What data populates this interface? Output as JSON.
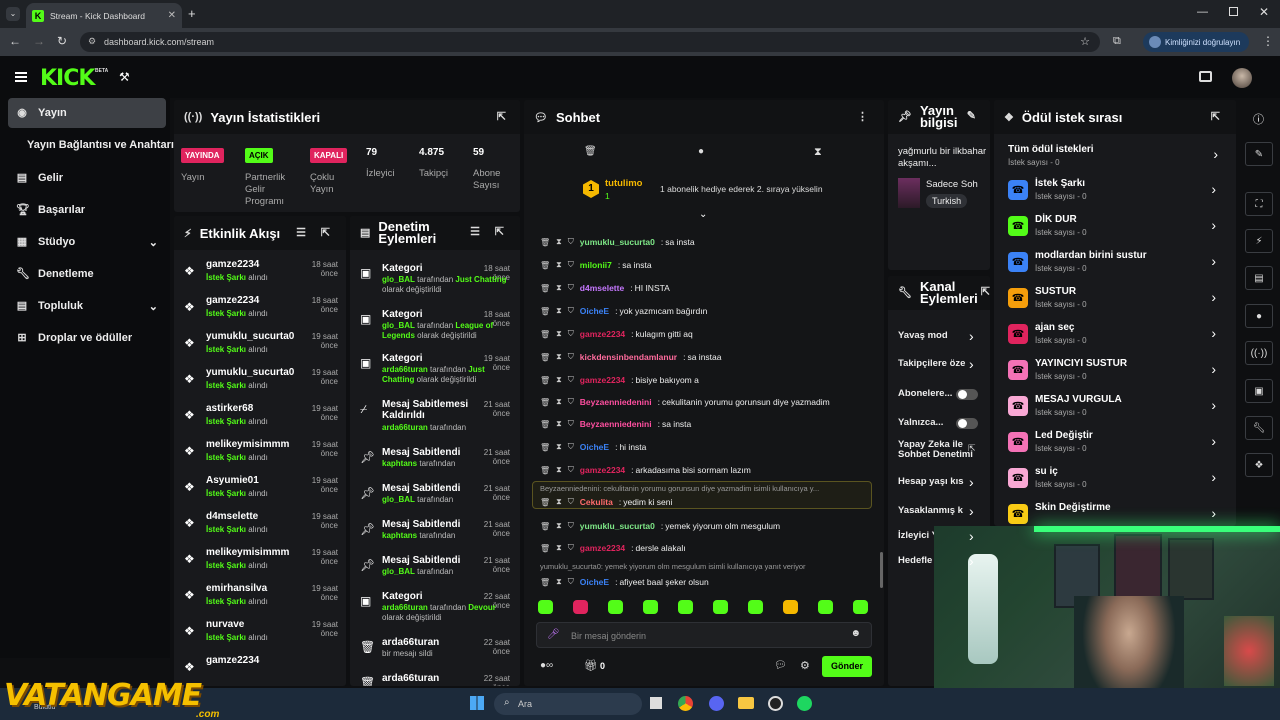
{
  "browser": {
    "tab_title": "Stream - Kick Dashboard",
    "url": "dashboard.kick.com/stream",
    "verify_label": "Kimliğinizi doğrulayın"
  },
  "app": {
    "logo": "KICK",
    "beta": "BETA"
  },
  "sidebar": {
    "items": [
      {
        "label": "Yayın",
        "icon": "broadcast-icon"
      },
      {
        "label": "Yayın Bağlantısı ve Anahtarı",
        "icon": ""
      },
      {
        "label": "Gelir",
        "icon": "dollar-icon"
      },
      {
        "label": "Başarılar",
        "icon": "trophy-icon"
      },
      {
        "label": "Stüdyo",
        "icon": "studio-icon"
      },
      {
        "label": "Denetleme",
        "icon": "wrench-icon"
      },
      {
        "label": "Topluluk",
        "icon": "community-icon"
      },
      {
        "label": "Droplar ve ödüller",
        "icon": "gift-icon"
      }
    ]
  },
  "stats": {
    "title": "Yayın İstatistikleri",
    "status_badge": "YAYINDA",
    "status_label": "Yayın",
    "partner_badge": "AÇIK",
    "partner_label": "Partnerlik Gelir Programı",
    "multi_badge": "KAPALI",
    "multi_label": "Çoklu Yayın",
    "viewers": "79",
    "viewers_label": "İzleyici",
    "followers": "4.875",
    "followers_label": "Takipçi",
    "subs": "59",
    "subs_label": "Abone Sayısı"
  },
  "events": {
    "title": "Etkinlik Akışı",
    "action_word": "İstek Şarkı",
    "suffix": "alındı",
    "rows": [
      {
        "name": "gamze2234",
        "time": "18 saat önce"
      },
      {
        "name": "gamze2234",
        "time": "18 saat önce"
      },
      {
        "name": "yumuklu_sucurta0",
        "time": "19 saat önce"
      },
      {
        "name": "yumuklu_sucurta0",
        "time": "19 saat önce"
      },
      {
        "name": "astirker68",
        "time": "19 saat önce"
      },
      {
        "name": "melikeymisimmm",
        "time": "19 saat önce"
      },
      {
        "name": "Asyumie01",
        "time": "19 saat önce"
      },
      {
        "name": "d4mselette",
        "time": "19 saat önce"
      },
      {
        "name": "melikeymisimmm",
        "time": "19 saat önce"
      },
      {
        "name": "emirhansilva",
        "time": "19 saat önce"
      },
      {
        "name": "nurvave",
        "time": "19 saat önce"
      },
      {
        "name": "gamze2234",
        "time": ""
      }
    ]
  },
  "moderation": {
    "title": "Denetim Eylemleri",
    "rows": [
      {
        "title": "Kategori",
        "time": "18 saat önce",
        "user": "glo_BAL",
        "mid": " tarafından ",
        "extra": "Just Chatting",
        "tail": " olarak değiştirildi",
        "icon": "category-icon"
      },
      {
        "title": "Kategori",
        "time": "18 saat önce",
        "user": "glo_BAL",
        "mid": " tarafından ",
        "extra": "League of Legends",
        "tail": " olarak değiştirildi",
        "icon": "category-icon"
      },
      {
        "title": "Kategori",
        "time": "19 saat önce",
        "user": "arda66turan",
        "mid": " tarafından ",
        "extra": "Just Chatting",
        "tail": " olarak değiştirildi",
        "icon": "category-icon"
      },
      {
        "title": "Mesaj Sabitlemesi Kaldırıldı",
        "time": "21 saat önce",
        "user": "arda66turan",
        "mid": " tarafından",
        "extra": "",
        "tail": "",
        "icon": "unpin-icon"
      },
      {
        "title": "Mesaj Sabitlendi",
        "time": "21 saat önce",
        "user": "kaphtans",
        "mid": " tarafından",
        "extra": "",
        "tail": "",
        "icon": "pin-icon"
      },
      {
        "title": "Mesaj Sabitlendi",
        "time": "21 saat önce",
        "user": "glo_BAL",
        "mid": " tarafından",
        "extra": "",
        "tail": "",
        "icon": "pin-icon"
      },
      {
        "title": "Mesaj Sabitlendi",
        "time": "21 saat önce",
        "user": "kaphtans",
        "mid": " tarafından",
        "extra": "",
        "tail": "",
        "icon": "pin-icon"
      },
      {
        "title": "Mesaj Sabitlendi",
        "time": "21 saat önce",
        "user": "glo_BAL",
        "mid": " tarafından",
        "extra": "",
        "tail": "",
        "icon": "pin-icon"
      },
      {
        "title": "Kategori",
        "time": "22 saat önce",
        "user": "arda66turan",
        "mid": " tarafından ",
        "extra": "Devour",
        "tail": " olarak değiştirildi",
        "icon": "category-icon"
      },
      {
        "title": "arda66turan",
        "time": "22 saat önce",
        "user": "",
        "mid": "bir mesajı sildi",
        "extra": "",
        "tail": "",
        "icon": "trash-icon"
      },
      {
        "title": "arda66turan",
        "time": "22 saat önce",
        "user": "",
        "mid": "",
        "extra": "",
        "tail": "",
        "icon": "trash-icon"
      }
    ]
  },
  "chat": {
    "title": "Sohbet",
    "gifter_name": "tutulimo",
    "gifter_count": "1",
    "gift_text": "1 abonelik hediye ederek 2. sıraya yükselin",
    "messages": [
      {
        "user": "yumuklu_sucurta0",
        "color": "#7ee787",
        "text": "sa insta"
      },
      {
        "user": "milonii7",
        "color": "#53fc18",
        "text": "sa insta"
      },
      {
        "user": "d4mselette",
        "color": "#c678ff",
        "text": "HI INSTA"
      },
      {
        "user": "OicheE",
        "color": "#3b82f6",
        "text": "yok yazmıcam bağırdın"
      },
      {
        "user": "gamze2234",
        "color": "#e0245e",
        "text": "kulagım gitti aq"
      },
      {
        "user": "kickdensinbendamlanur",
        "color": "#ff6b9d",
        "text": "sa instaa"
      },
      {
        "user": "gamze2234",
        "color": "#e0245e",
        "text": "bisiye bakıyom a"
      },
      {
        "user": "Beyzaenniedenini",
        "color": "#ff4fa0",
        "text": "cekulitanin yorumu gorunsun diye yazmadim"
      },
      {
        "user": "Beyzaenniedenini",
        "color": "#ff4fa0",
        "text": "sa insta"
      },
      {
        "user": "OicheE",
        "color": "#3b82f6",
        "text": "hi insta"
      },
      {
        "user": "gamze2234",
        "color": "#e0245e",
        "text": "arkadasıma bisi sormam lazım"
      },
      {
        "user": "Cekulita",
        "color": "#ff6b6b",
        "text": "yedim ki seni"
      },
      {
        "user": "yumuklu_sucurta0",
        "color": "#7ee787",
        "text": "yemek yiyorum olm mesgulum"
      },
      {
        "user": "gamze2234",
        "color": "#e0245e",
        "text": "dersle alakalı"
      },
      {
        "user": "OicheE",
        "color": "#3b82f6",
        "text": "afiyeet baal şeker olsun"
      }
    ],
    "reply1": "Beyzaenniedenini: cekulitanin yorumu gorunsun diye yazmadim isimli kullanıcıya y...",
    "reply2": "yumuklu_sucurta0: yemek yiyorum olm mesgulum isimli kullanıcıya yanıt veriyor",
    "input_placeholder": "Bir mesaj gönderin",
    "points": "0",
    "send_label": "Gönder"
  },
  "stream_info": {
    "title": "Yayın bilgisi",
    "stream_title": "yağmurlu bir ilkbahar akşamı...",
    "category": "Sadece Soh",
    "language": "Turkish"
  },
  "channel_actions": {
    "title": "Kanal Eylemleri",
    "items": [
      {
        "label": "Yavaş mod",
        "type": "arrow"
      },
      {
        "label": "Takipçilere öze",
        "type": "arrow"
      },
      {
        "label": "Abonelere...",
        "type": "toggle"
      },
      {
        "label": "Yalnızca...",
        "type": "toggle"
      },
      {
        "label": "Yapay Zeka ile Sohbet Denetimi",
        "type": "link"
      },
      {
        "label": "Hesap yaşı kıs",
        "type": "arrow"
      },
      {
        "label": "Yasaklanmış k",
        "type": "arrow"
      },
      {
        "label": "İzleyici Y",
        "type": "arrow"
      },
      {
        "label": "Hedefle",
        "type": "arrow"
      }
    ]
  },
  "rewards": {
    "title": "Ödül istek sırası",
    "all_label": "Tüm ödül istekleri",
    "all_count": "İstek sayısı - 0",
    "items": [
      {
        "name": "İstek Şarkı",
        "count": "İstek sayısı - 0",
        "color": "#3b82f6"
      },
      {
        "name": "DİK DUR",
        "count": "İstek sayısı - 0",
        "color": "#53fc18"
      },
      {
        "name": "modlardan birini sustur",
        "count": "İstek sayısı - 0",
        "color": "#3b82f6"
      },
      {
        "name": "SUSTUR",
        "count": "İstek sayısı - 0",
        "color": "#f59e0b"
      },
      {
        "name": "ajan seç",
        "count": "İstek sayısı - 0",
        "color": "#e0245e"
      },
      {
        "name": "YAYINCIYI SUSTUR",
        "count": "İstek sayısı - 0",
        "color": "#f472b6"
      },
      {
        "name": "MESAJ VURGULA",
        "count": "İstek sayısı - 0",
        "color": "#f9a8d4"
      },
      {
        "name": "Led Değiştir",
        "count": "İstek sayısı - 0",
        "color": "#f472b6"
      },
      {
        "name": "su iç",
        "count": "İstek sayısı - 0",
        "color": "#f9a8d4"
      },
      {
        "name": "Skin Değiştirme",
        "count": "",
        "color": "#facc15"
      }
    ]
  },
  "taskbar": {
    "search_placeholder": "Ara",
    "weather": "Bulutlu",
    "watermark": "VATANGAME",
    "watermark_sub": ".com"
  }
}
